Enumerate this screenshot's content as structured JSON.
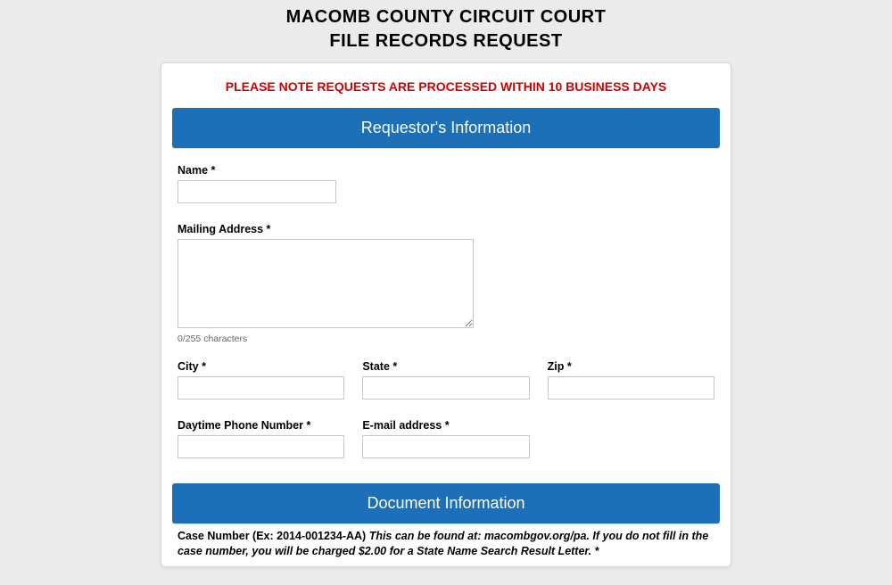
{
  "header": {
    "title_line1": "MACOMB COUNTY CIRCUIT COURT",
    "title_line2": "FILE RECORDS REQUEST"
  },
  "notice": "PLEASE NOTE REQUESTS ARE PROCESSED WITHIN 10 BUSINESS DAYS",
  "sections": {
    "requestor": "Requestor's Information",
    "document": "Document Information"
  },
  "fields": {
    "name": {
      "label": "Name *",
      "value": ""
    },
    "mailing_address": {
      "label": "Mailing Address *",
      "value": "",
      "counter": "0/255 characters"
    },
    "city": {
      "label": "City *",
      "value": ""
    },
    "state": {
      "label": "State *",
      "value": ""
    },
    "zip": {
      "label": "Zip *",
      "value": ""
    },
    "phone": {
      "label": "Daytime Phone Number *",
      "value": ""
    },
    "email": {
      "label": "E-mail address *",
      "value": ""
    }
  },
  "case_number_note": {
    "lead": "Case Number (Ex: 2014-001234-AA) ",
    "rest": "This can be found at: macombgov.org/pa.  If you do not fill in the case number, you will be charged $2.00 for a State Name Search Result Letter. *"
  }
}
